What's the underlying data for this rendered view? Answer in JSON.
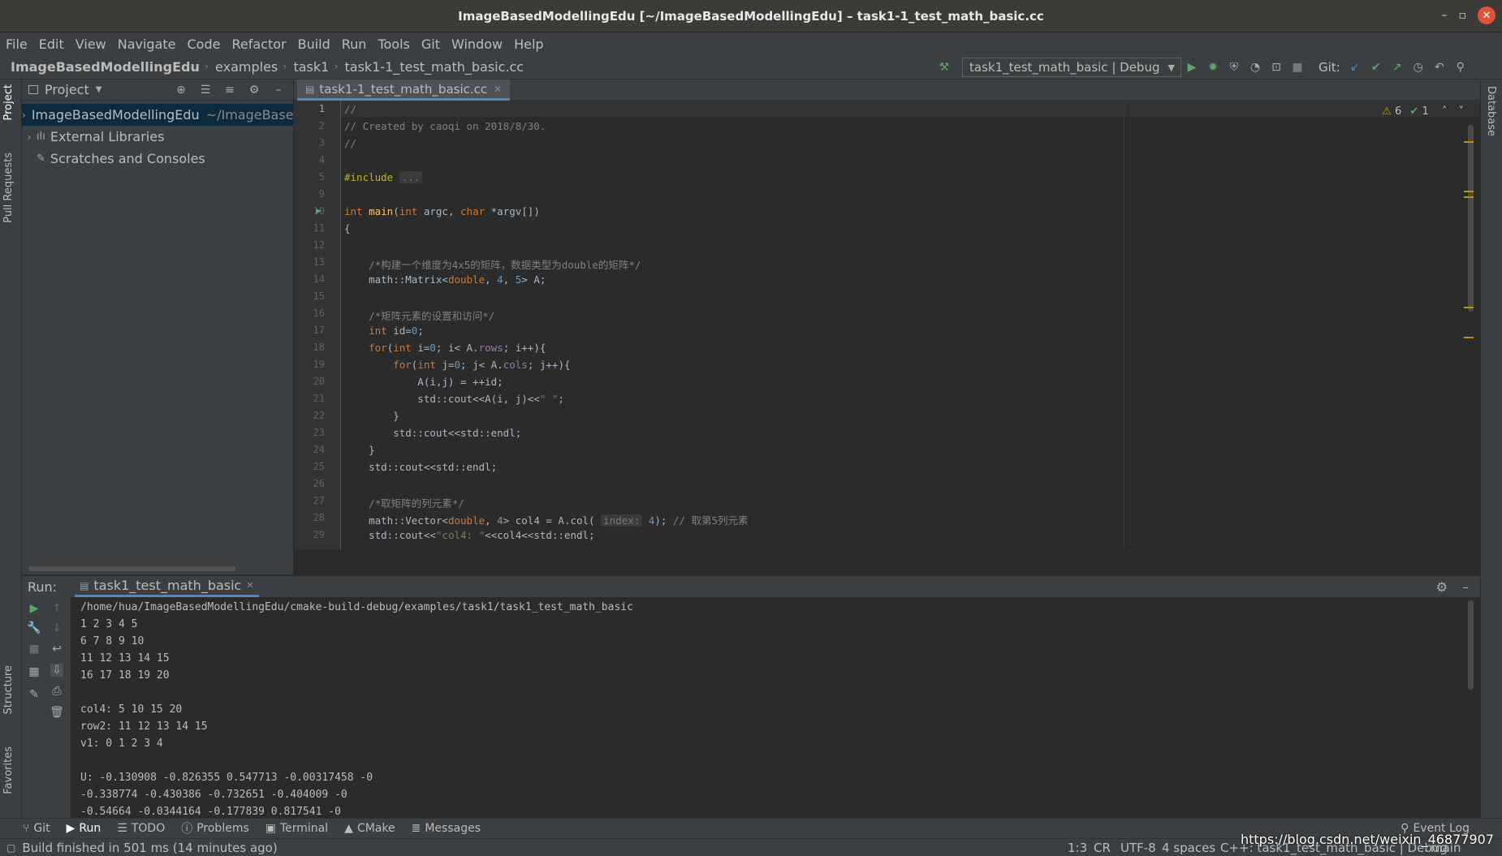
{
  "window": {
    "title": "ImageBasedModellingEdu [~/ImageBasedModellingEdu] – task1-1_test_math_basic.cc"
  },
  "menu": [
    "File",
    "Edit",
    "View",
    "Navigate",
    "Code",
    "Refactor",
    "Build",
    "Run",
    "Tools",
    "Git",
    "Window",
    "Help"
  ],
  "breadcrumbs": [
    "ImageBasedModellingEdu",
    "examples",
    "task1",
    "task1-1_test_math_basic.cc"
  ],
  "run_config": "task1_test_math_basic | Debug",
  "git_label": "Git:",
  "left_tabs": {
    "project": "Project",
    "pull": "Pull Requests",
    "structure": "Structure",
    "favorites": "Favorites"
  },
  "right_tabs": {
    "database": "Database"
  },
  "project": {
    "title": "Project",
    "items": [
      {
        "label": "ImageBasedModellingEdu",
        "path": "~/ImageBasedM"
      },
      {
        "label": "External Libraries"
      },
      {
        "label": "Scratches and Consoles"
      }
    ]
  },
  "editor": {
    "tab": "task1-1_test_math_basic.cc",
    "warnings": "6",
    "checks": "1",
    "line_numbers": [
      "1",
      "2",
      "3",
      "4",
      "5",
      "9",
      "10",
      "11",
      "12",
      "13",
      "14",
      "15",
      "16",
      "17",
      "18",
      "19",
      "20",
      "21",
      "22",
      "23",
      "24",
      "25",
      "26",
      "27",
      "28",
      "29"
    ]
  },
  "run": {
    "label": "Run:",
    "tab": "task1_test_math_basic",
    "output": [
      "/home/hua/ImageBasedModellingEdu/cmake-build-debug/examples/task1/task1_test_math_basic",
      "1 2 3 4 5",
      "6 7 8 9 10",
      "11 12 13 14 15",
      "16 17 18 19 20",
      "",
      "col4: 5 10 15 20",
      "row2: 11 12 13 14 15",
      "v1: 0 1 2 3 4",
      "",
      "U: -0.130908 -0.826355 0.547713 -0.00317458 -0",
      "-0.338774 -0.430386 -0.732651 -0.404009 -0",
      "-0.54664 -0.0344164 -0.177839 0.817541 -0"
    ]
  },
  "toolwindows": [
    "Git",
    "Run",
    "TODO",
    "Problems",
    "Terminal",
    "CMake",
    "Messages"
  ],
  "event_log": "Event Log",
  "status": {
    "message": "Build finished in 501 ms (14 minutes ago)",
    "position": "1:3",
    "line_sep": "CR",
    "encoding": "UTF-8",
    "indent": "4 spaces",
    "context": "C++: task1_test_math_basic | Debug",
    "branch": "main"
  },
  "watermark": "https://blog.csdn.net/weixin_46877907"
}
